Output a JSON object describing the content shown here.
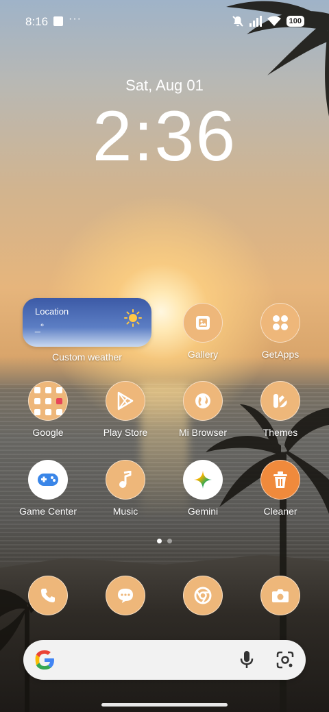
{
  "status_bar": {
    "time": "8:16",
    "dots": "···",
    "battery": "100"
  },
  "lockclock": {
    "date": "Sat, Aug 01",
    "time": "2:36"
  },
  "weather_widget": {
    "location": "Location",
    "temperature": "_°",
    "label": "Custom weather",
    "icon": "sun-icon"
  },
  "apps": {
    "gallery": "Gallery",
    "getapps": "GetApps",
    "google": "Google",
    "playstore": "Play Store",
    "mibrowser": "Mi Browser",
    "themes": "Themes",
    "gamecenter": "Game Center",
    "music": "Music",
    "gemini": "Gemini",
    "cleaner": "Cleaner"
  },
  "dock": [
    "phone-icon",
    "messages-icon",
    "chrome-icon",
    "camera-icon"
  ],
  "colors": {
    "icon_bg": "#eeb77a",
    "widget_top": "#3c5aa6",
    "search_bg": "#f2f2f2"
  }
}
